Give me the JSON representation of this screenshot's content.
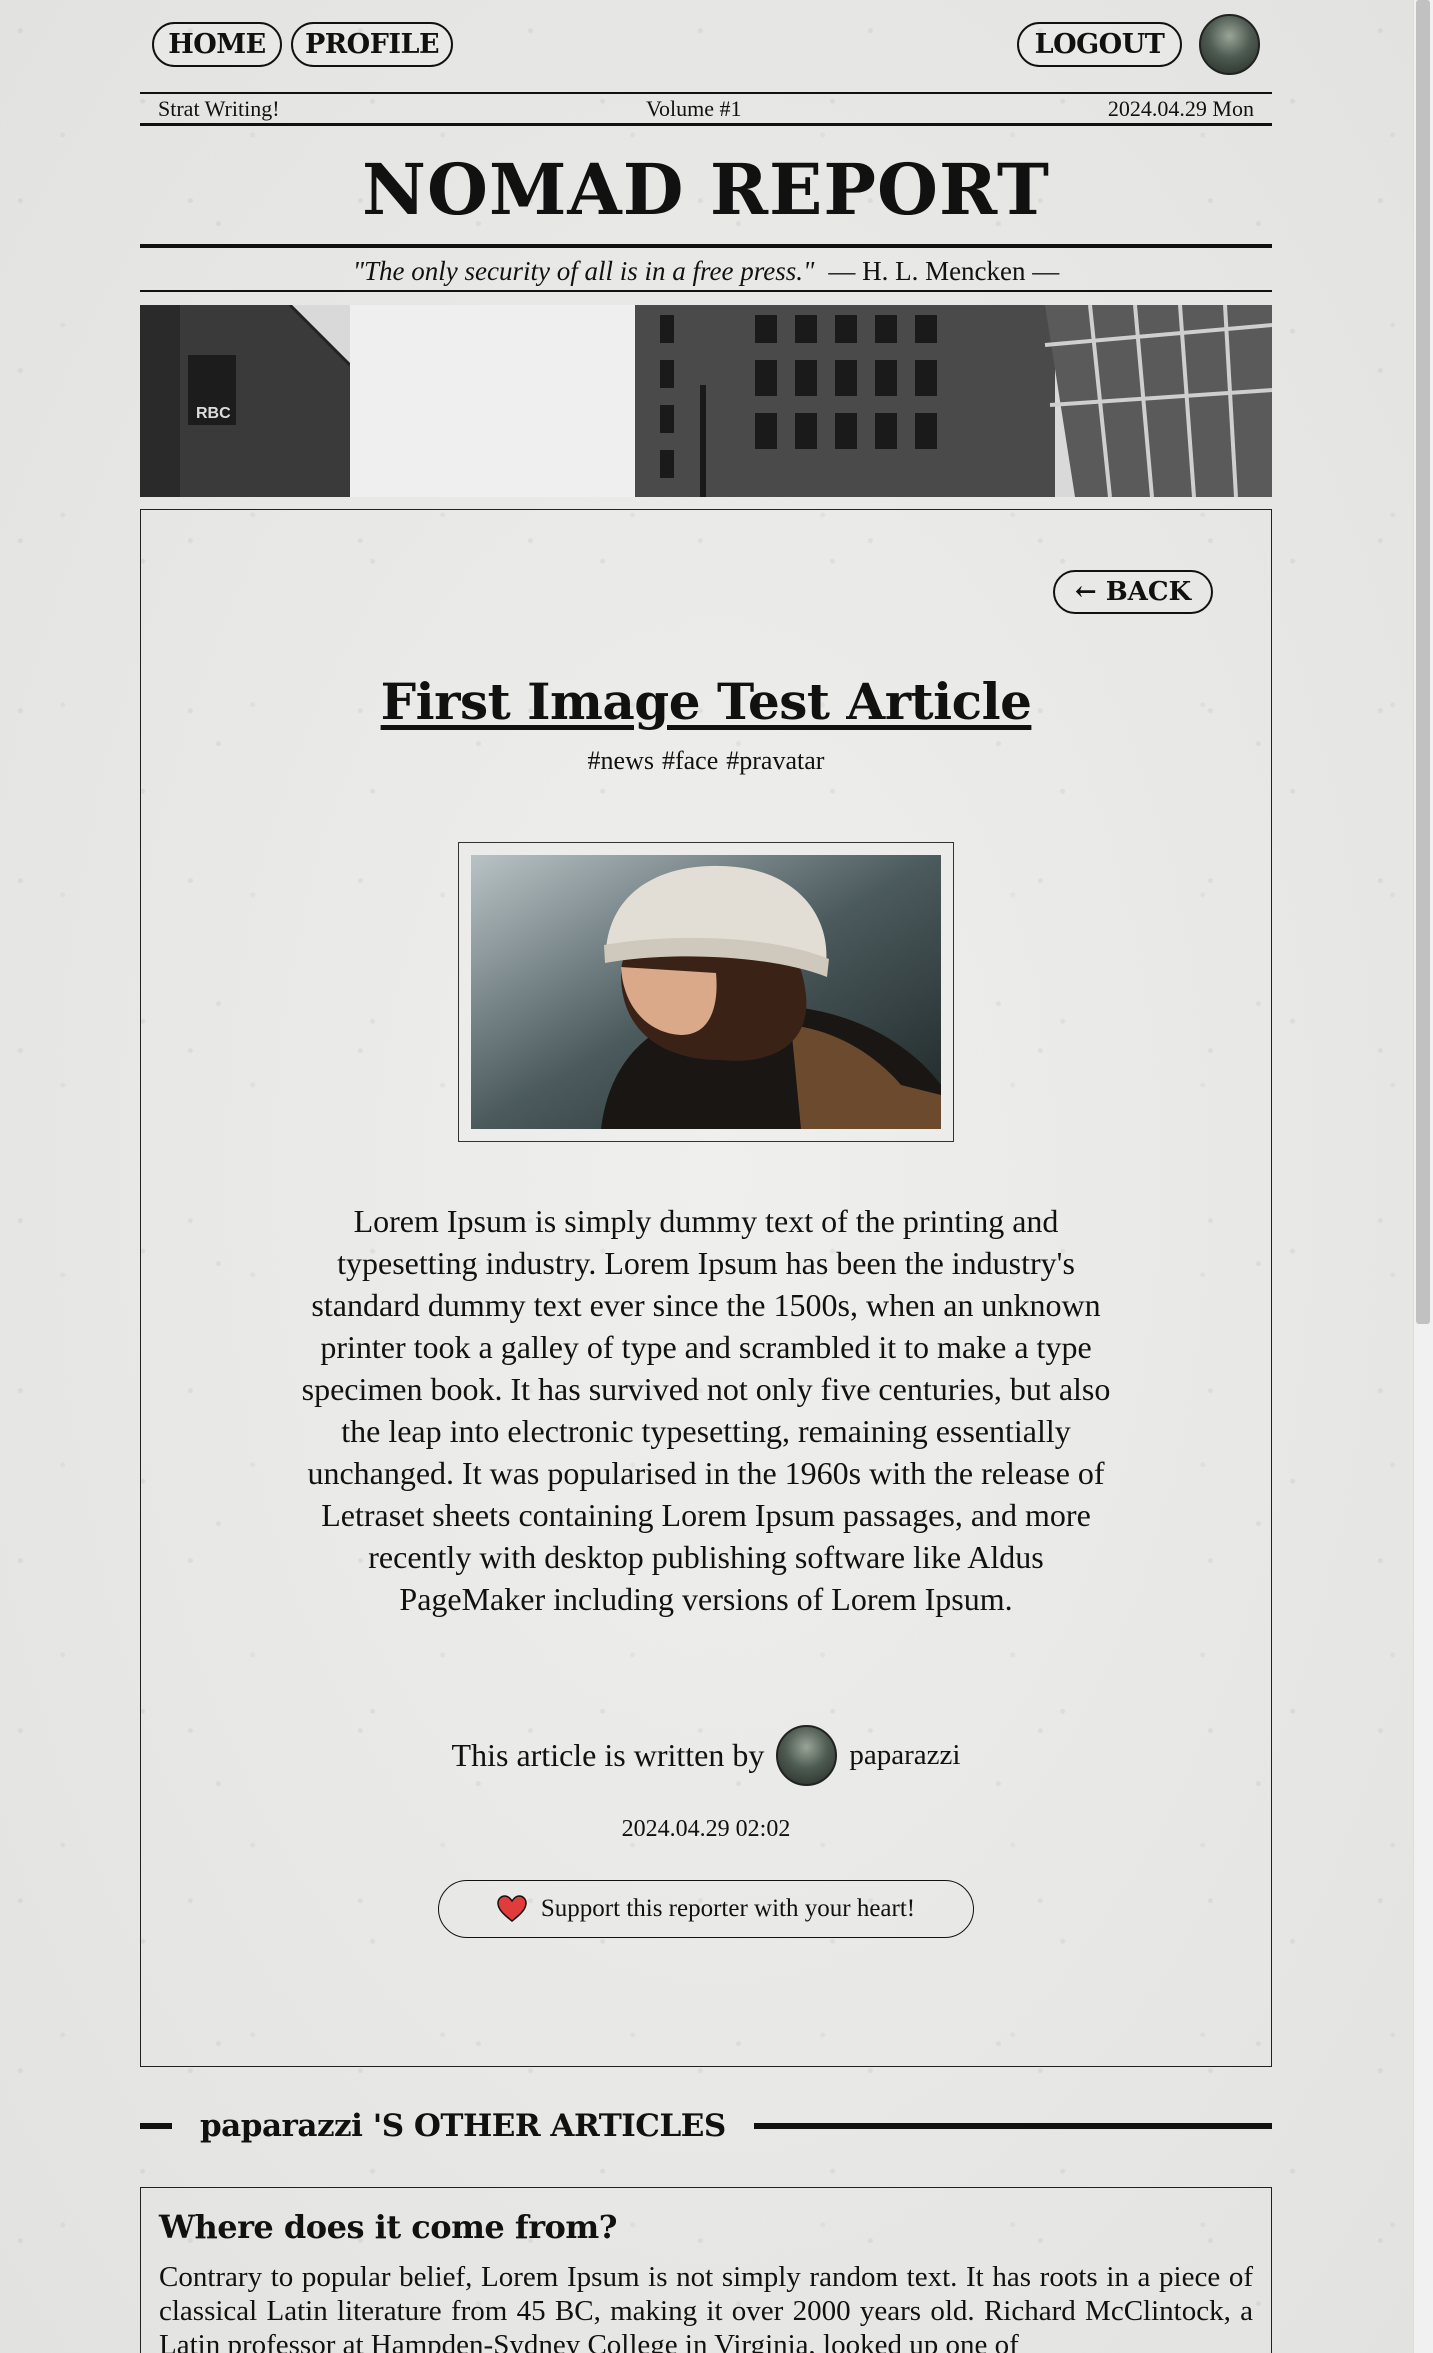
{
  "nav": {
    "home": "HOME",
    "profile": "PROFILE",
    "logout": "LOGOUT"
  },
  "dateline": {
    "left": "Strat Writing!",
    "center": "Volume #1",
    "right": "2024.04.29 Mon"
  },
  "masthead": "NOMAD REPORT",
  "quote": {
    "text": "\"The only security of all is in a free press.\"",
    "author": "— H. L. Mencken —"
  },
  "banner_sign": "RBC",
  "article": {
    "back": "← BACK",
    "title": "First Image Test Article",
    "tags": [
      "#news",
      "#face",
      "#pravatar"
    ],
    "body": "Lorem Ipsum is simply dummy text of the printing and typesetting industry. Lorem Ipsum has been the industry's standard dummy text ever since the 1500s, when an unknown printer took a galley of type and scrambled it to make a type specimen book. It has survived not only five centuries, but also the leap into electronic typesetting, remaining essentially unchanged. It was popularised in the 1960s with the release of Letraset sheets containing Lorem Ipsum passages, and more recently with desktop publishing software like Aldus PageMaker including versions of Lorem Ipsum.",
    "byline_prefix": "This article is written by",
    "author": "paparazzi",
    "timestamp": "2024.04.29 02:02",
    "support": "Support this reporter with your heart!"
  },
  "other_articles": {
    "heading": "paparazzi 'S OTHER ARTICLES",
    "items": [
      {
        "title": "Where does it come from?",
        "excerpt": "Contrary to popular belief, Lorem Ipsum is not simply random text. It has roots in a piece of classical Latin literature from 45 BC, making it over 2000 years old. Richard McClintock, a Latin professor at Hampden-Sydney College in Virginia, looked up one of"
      }
    ]
  },
  "icons": {
    "heart": "heart-icon",
    "avatar": "avatar"
  },
  "colors": {
    "ink": "#111111",
    "paper": "#e8e8e6",
    "heart": "#e23b3b"
  }
}
